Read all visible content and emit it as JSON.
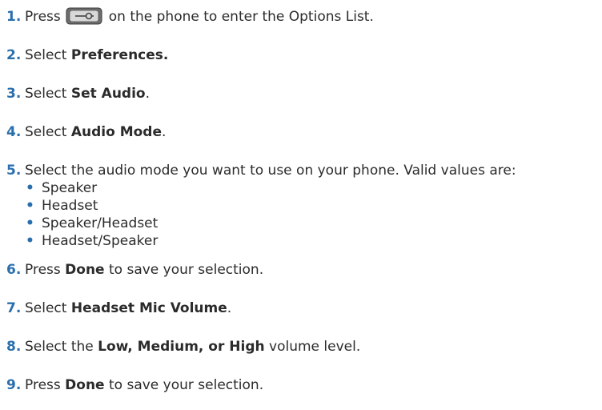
{
  "steps": [
    {
      "number": "1.",
      "pre": "Press",
      "post": "on the phone to enter the Options List."
    },
    {
      "number": "2.",
      "pre": "Select ",
      "bold": "Preferences.",
      "post": ""
    },
    {
      "number": "3.",
      "pre": "Select ",
      "bold": "Set Audio",
      "post": "."
    },
    {
      "number": "4.",
      "pre": "Select ",
      "bold": "Audio Mode",
      "post": "."
    },
    {
      "number": "5.",
      "pre": "Select the audio mode you want to use on your phone. Valid values are:",
      "bold": "",
      "post": ""
    },
    {
      "number": "6.",
      "pre": "Press ",
      "bold": "Done",
      "post": " to save your selection."
    },
    {
      "number": "7.",
      "pre": "Select ",
      "bold": "Headset Mic Volume",
      "post": "."
    },
    {
      "number": "8.",
      "pre": "Select the ",
      "bold": "Low, Medium, or High",
      "post": " volume level."
    },
    {
      "number": "9.",
      "pre": "Press ",
      "bold": "Done",
      "post": " to save your selection."
    }
  ],
  "audio_modes": [
    "Speaker",
    "Headset",
    "Speaker/Headset",
    "Headset/Speaker"
  ],
  "bullet_char": "•",
  "colors": {
    "accent": "#2a6fad",
    "text": "#2b2b2b",
    "icon_body": "#6d6d6d",
    "icon_face": "#d9d9d9"
  },
  "icons": {
    "options_key": "options-key-icon"
  }
}
